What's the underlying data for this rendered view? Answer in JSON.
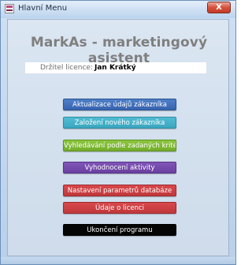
{
  "window": {
    "title": "Hlavní Menu",
    "close_label": "X"
  },
  "panel": {
    "heading": "MarkAs - marketingový asistent",
    "licence_label": "Držitel licence:",
    "licence_value": "Jan Krátký"
  },
  "buttons": [
    {
      "label": "Aktualizace údajů zákazníka",
      "color": "#3f6fbe"
    },
    {
      "label": "Založení nového zákazníka",
      "color": "#45b0c9"
    },
    {
      "label": "Vyhledávání podle zadaných kritérií",
      "color": "#7fba35"
    },
    {
      "label": "Vyhodnocení aktivity",
      "color": "#7449aa"
    },
    {
      "label": "Nastavení parametrů databáze",
      "color": "#cc4043"
    },
    {
      "label": "Údaje o licenci",
      "color": "#cc4043"
    },
    {
      "label": "Ukončení programu",
      "color": "#050505"
    }
  ]
}
